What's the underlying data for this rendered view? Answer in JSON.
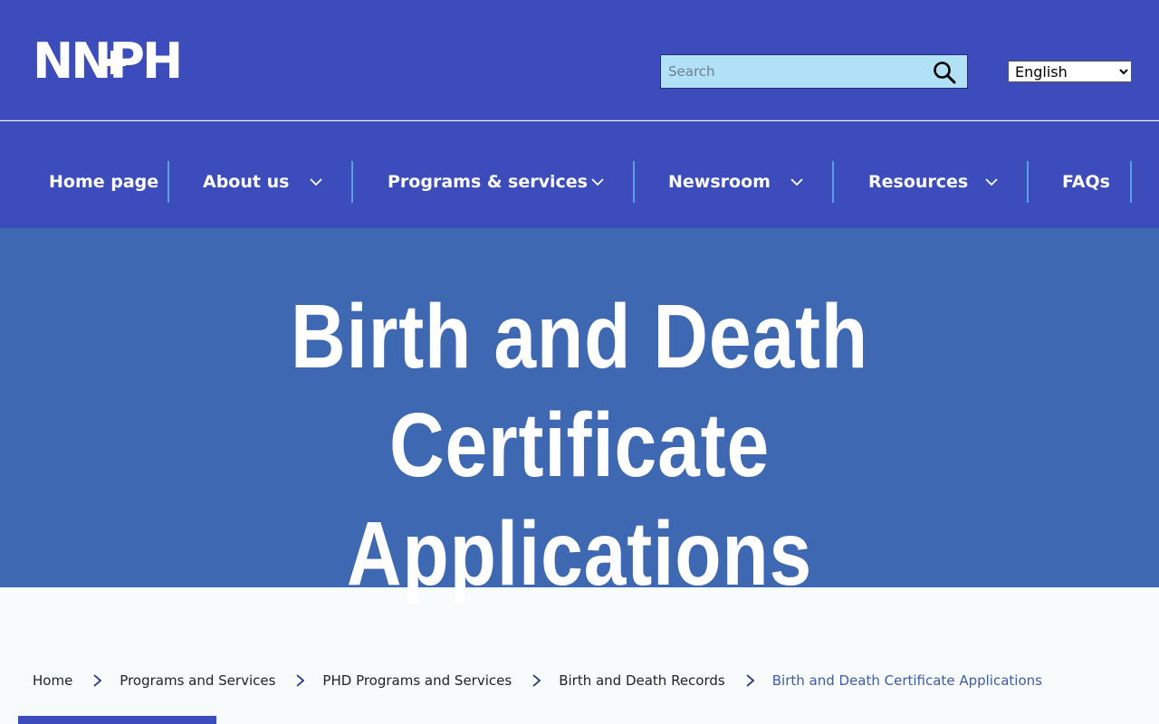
{
  "header": {
    "logo_text": "NNPH",
    "search": {
      "placeholder": "Search",
      "value": ""
    },
    "language": {
      "selected": "English",
      "options": [
        "English"
      ]
    }
  },
  "nav": {
    "items": [
      {
        "label": "Home page",
        "has_dropdown": false
      },
      {
        "label": "About us",
        "has_dropdown": true
      },
      {
        "label": "Programs & services",
        "has_dropdown": true
      },
      {
        "label": "Newsroom",
        "has_dropdown": true
      },
      {
        "label": "Resources",
        "has_dropdown": true
      },
      {
        "label": "FAQs",
        "has_dropdown": false
      }
    ]
  },
  "hero": {
    "title_line1": "Birth and Death Certificate",
    "title_line2": "Applications"
  },
  "breadcrumb": {
    "items": [
      "Home",
      "Programs and Services",
      "PHD Programs and Services",
      "Birth and Death Records",
      "Birth and Death Certificate Applications"
    ]
  },
  "colors": {
    "header_bg": "#3c4dbb",
    "hero_bg": "#3e68b1",
    "search_bg": "#b1e1f7",
    "nav_separator": "#5ba0e3",
    "breadcrumb_current": "#3e5aa8",
    "page_bg": "#f7fbfc"
  },
  "icons": {
    "search": "search-icon",
    "chevron": "chevron-down-icon",
    "breadcrumb_separator": "chevron-right-icon"
  }
}
